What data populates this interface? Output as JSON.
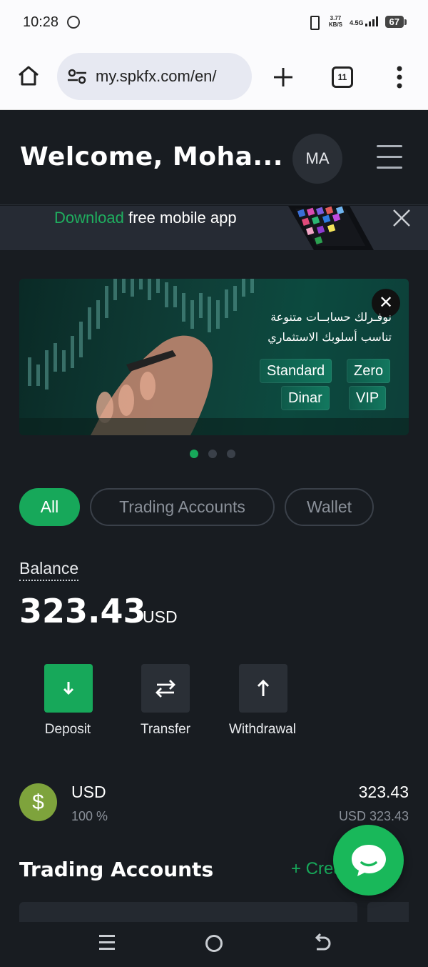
{
  "status_bar": {
    "time": "10:28",
    "net_speed_top": "3.77",
    "net_speed_bottom": "KB/S",
    "network": "4.5G",
    "battery": "67"
  },
  "browser": {
    "url": "my.spkfx.com/en/",
    "tab_count": "11"
  },
  "header": {
    "welcome": "Welcome, Moha...",
    "avatar_initials": "MA"
  },
  "download_banner": {
    "highlight": "Download",
    "rest": " free mobile app"
  },
  "promo": {
    "line1": "نوفـرلك حسابــات متنوعة",
    "line2": "تناسب أسلوبك الاستثماري",
    "pills": [
      "Standard",
      "Zero",
      "Dinar",
      "VIP"
    ],
    "close_label": "✕"
  },
  "carousel": {
    "count": 3,
    "active": 0
  },
  "filters": {
    "all": "All",
    "trading_accounts": "Trading Accounts",
    "wallet": "Wallet",
    "active": "All"
  },
  "balance": {
    "label": "Balance",
    "value": "323.43",
    "currency": "USD"
  },
  "actions": {
    "deposit": "Deposit",
    "transfer": "Transfer",
    "withdrawal": "Withdrawal"
  },
  "currency_row": {
    "symbol": "$",
    "name": "USD",
    "percent": "100 %",
    "amount": "323.43",
    "amount_sub": "USD 323.43"
  },
  "trading_accounts": {
    "title": "Trading Accounts",
    "create_new": "+ Create New"
  },
  "colors": {
    "accent": "#17a85a",
    "background": "#181c21",
    "card": "#2a2f36",
    "usd_badge": "#7ea33c"
  }
}
